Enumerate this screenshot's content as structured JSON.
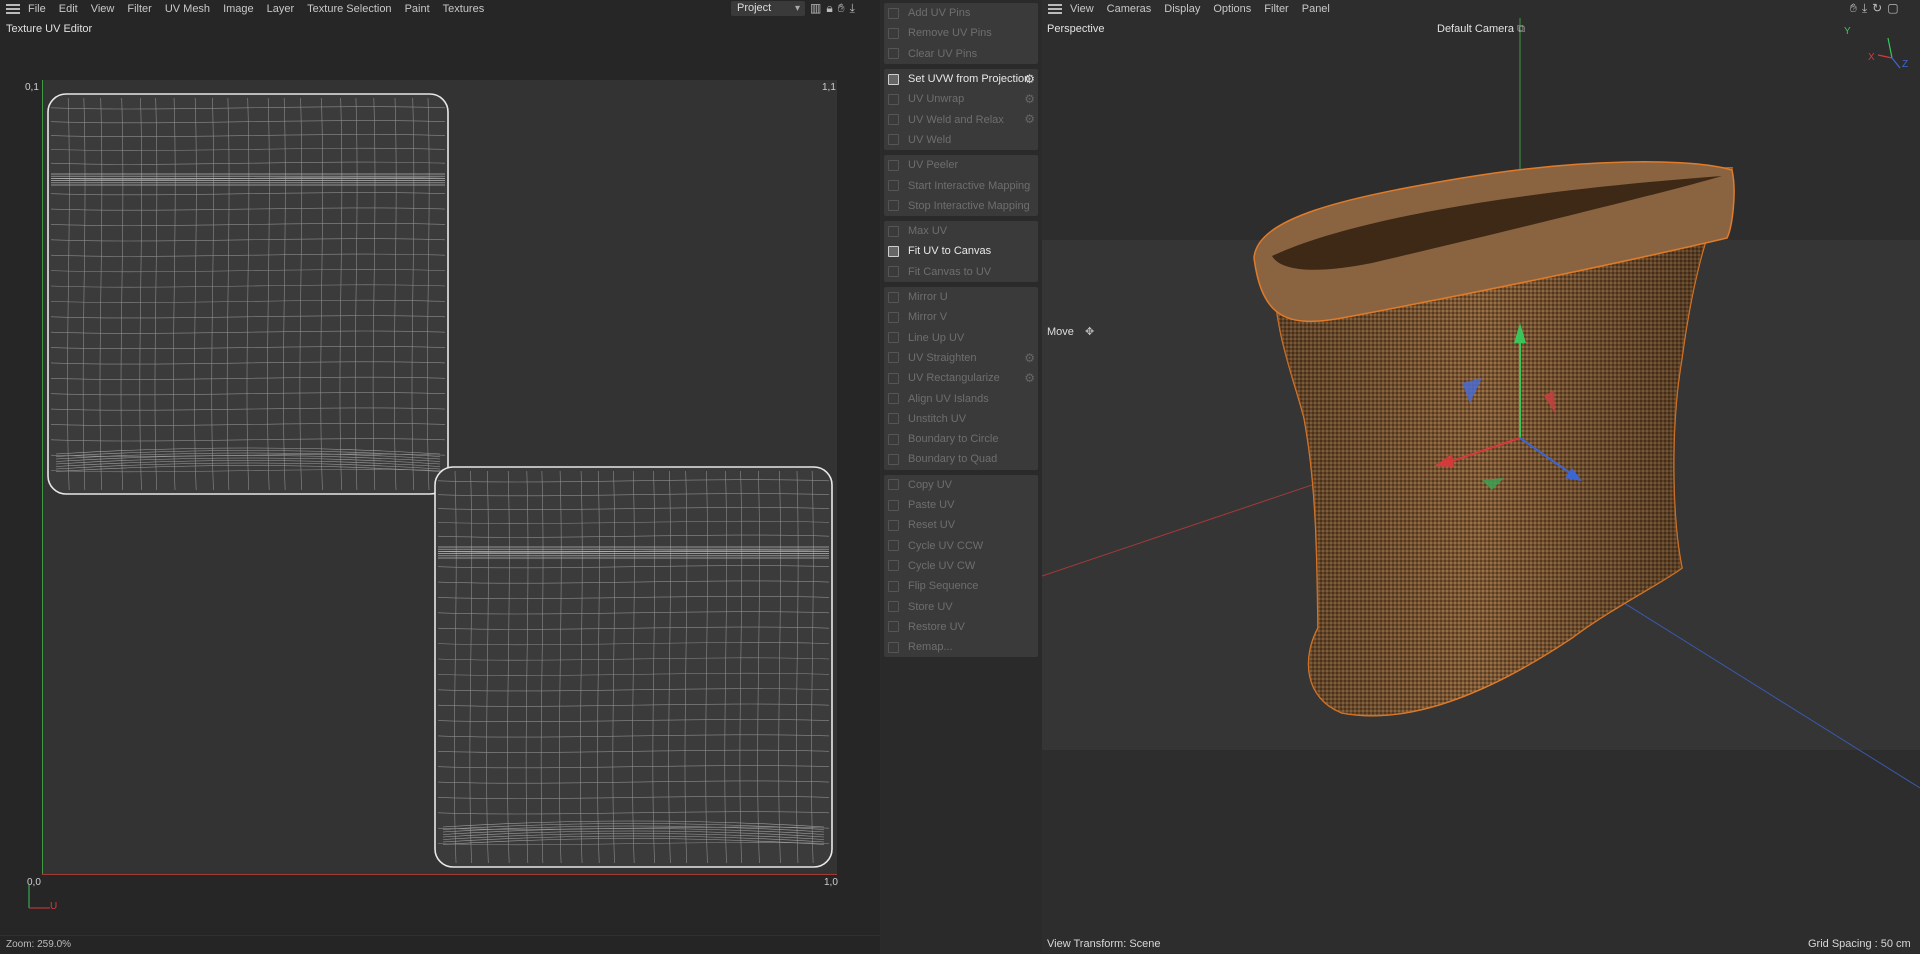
{
  "uv_editor": {
    "menu": [
      "File",
      "Edit",
      "View",
      "Filter",
      "UV Mesh",
      "Image",
      "Layer",
      "Texture Selection",
      "Paint",
      "Textures"
    ],
    "panel_title": "Texture UV Editor",
    "project_select": "Project",
    "corner_labels": {
      "top_left": "0,1",
      "top_right": "1,1",
      "bottom_left": "0,0",
      "bottom_right": "1,0"
    },
    "axis_u": "U",
    "zoom": "Zoom: 259.0%"
  },
  "palette": {
    "groups": [
      [
        "Add UV Pins",
        "Remove UV Pins",
        "Clear UV Pins"
      ],
      [
        "Set UVW from Projection",
        "UV Unwrap",
        "UV Weld and Relax",
        "UV Weld"
      ],
      [
        "UV Peeler",
        "Start Interactive Mapping",
        "Stop Interactive Mapping"
      ],
      [
        "Max UV",
        "Fit UV to Canvas",
        "Fit Canvas to UV"
      ],
      [
        "Mirror U",
        "Mirror V",
        "Line Up UV",
        "UV Straighten",
        "UV Rectangularize",
        "Align UV Islands",
        "Unstitch UV",
        "Boundary to Circle",
        "Boundary to Quad"
      ],
      [
        "Copy UV",
        "Paste UV",
        "Reset UV",
        "Cycle UV CCW",
        "Cycle UV CW",
        "Flip Sequence",
        "Store UV",
        "Restore UV",
        "Remap..."
      ]
    ],
    "active": [
      "Set UVW from Projection",
      "Fit UV to Canvas"
    ],
    "with_settings": [
      "Set UVW from Projection",
      "UV Unwrap",
      "UV Weld and Relax",
      "UV Straighten",
      "UV Rectangularize"
    ]
  },
  "viewport": {
    "menu": [
      "View",
      "Cameras",
      "Display",
      "Options",
      "Filter",
      "Panel"
    ],
    "title": "Perspective",
    "camera": "Default Camera",
    "tool": "Move",
    "view_transform": "View Transform: Scene",
    "grid_spacing": "Grid Spacing : 50 cm",
    "axis_labels": {
      "x": "X",
      "y": "Y",
      "z": "Z"
    }
  },
  "colors": {
    "accent_orange": "#e07b2a",
    "axis_x": "#d33b3b",
    "axis_y": "#3bc45a",
    "axis_z": "#3b66d3",
    "sack": "#7a5633"
  }
}
